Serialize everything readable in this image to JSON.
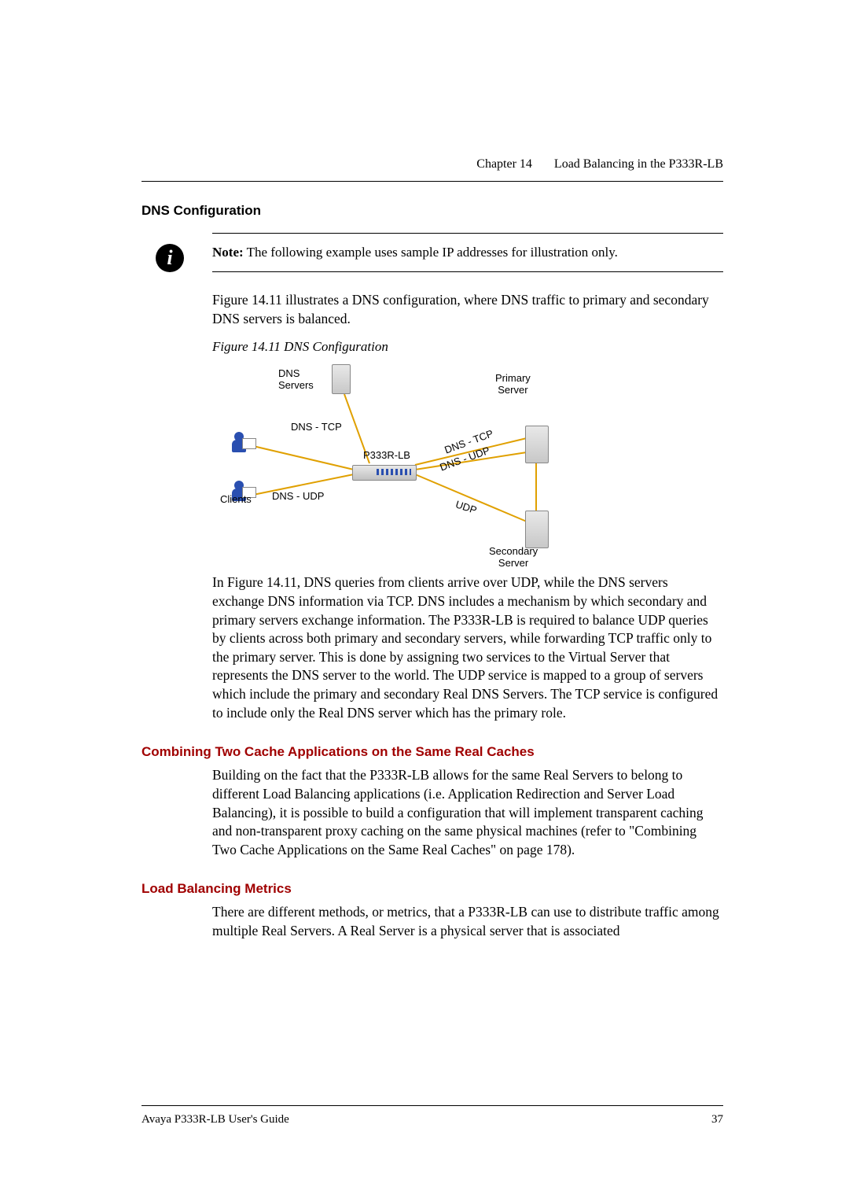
{
  "header": {
    "chapter": "Chapter 14",
    "title": "Load Balancing in the P333R-LB"
  },
  "section1": {
    "heading": "DNS Configuration",
    "note_label": "Note:",
    "note_text": "The following example uses sample IP addresses for illustration only.",
    "intro": "Figure 14.11 illustrates a DNS configuration, where DNS traffic to primary and secondary DNS servers is balanced.",
    "fig_caption": "Figure 14.11  DNS Configuration",
    "figure_labels": {
      "dns_servers": "DNS\nServers",
      "primary": "Primary\nServer",
      "secondary": "Secondary\nServer",
      "clients": "Clients",
      "device": "P333R-LB",
      "dns_tcp": "DNS - TCP",
      "dns_udp": "DNS - UDP",
      "dns_tcp2": "DNS - TCP",
      "dns_udp2": "DNS - UDP",
      "udp": "UDP"
    },
    "body": "In Figure 14.11, DNS queries from clients arrive over UDP, while the DNS servers exchange DNS information via TCP. DNS includes a mechanism by which secondary and primary servers exchange information. The P333R-LB is required to balance UDP queries by clients across both primary and secondary servers, while forwarding TCP traffic only to the primary server. This is done by assigning two services to the Virtual Server that represents the DNS server to the world. The UDP service is mapped to a group of servers which include the primary and secondary Real DNS Servers. The TCP service is configured to include only the Real DNS server which has the primary role."
  },
  "section2": {
    "heading": "Combining Two Cache Applications on the Same Real Caches",
    "body": "Building on the fact that the P333R-LB allows for the same Real Servers to belong to different Load Balancing applications (i.e. Application Redirection and Server Load Balancing), it is possible to build a configuration that will implement transparent caching and non-transparent proxy caching on the same physical machines (refer to \"Combining Two Cache Applications on the Same Real Caches\" on page 178)."
  },
  "section3": {
    "heading": "Load Balancing Metrics",
    "body": "There are different methods, or metrics, that a P333R-LB can use to distribute traffic among multiple Real Servers. A Real Server is a physical server that is associated"
  },
  "footer": {
    "guide": "Avaya P333R-LB User's Guide",
    "page": "37"
  }
}
